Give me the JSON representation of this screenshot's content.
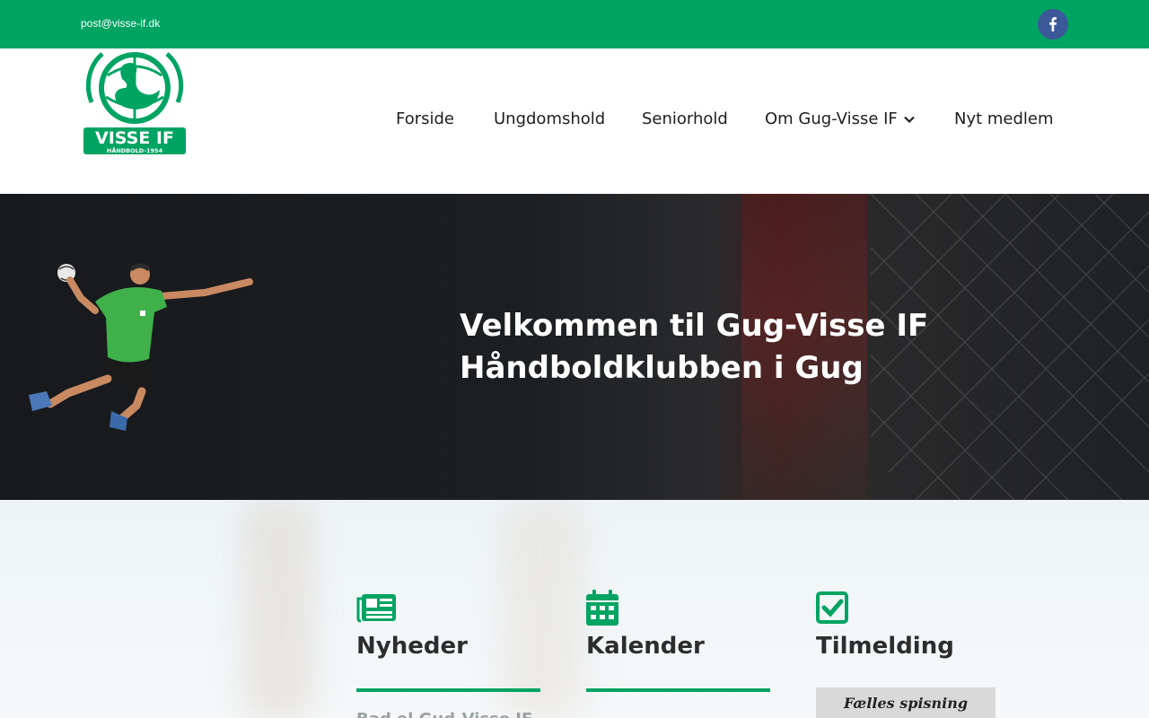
{
  "topbar": {
    "email": "post@visse-if.dk",
    "facebook_icon": "facebook-icon",
    "accent": "#00a462"
  },
  "logo": {
    "text_main": "VISSE IF",
    "text_sub": "HÅNDBOLD-1954"
  },
  "nav": {
    "items": [
      {
        "label": "Forside"
      },
      {
        "label": "Ungdomshold"
      },
      {
        "label": "Seniorhold"
      },
      {
        "label": "Om Gug-Visse IF",
        "has_dropdown": true
      },
      {
        "label": "Nyt medlem"
      }
    ]
  },
  "hero": {
    "line1": "Velkommen til Gug-Visse IF",
    "line2": "Håndboldklubben i Gug"
  },
  "sections": [
    {
      "title": "Nyheder",
      "icon": "newspaper-icon",
      "snippet": "Bad el Gud‑Visse IF"
    },
    {
      "title": "Kalender",
      "icon": "calendar-icon",
      "snippet": ""
    },
    {
      "title": "Tilmelding",
      "icon": "checkbox-icon",
      "snippet": ""
    }
  ],
  "event": {
    "label": "Fælles spisning"
  }
}
